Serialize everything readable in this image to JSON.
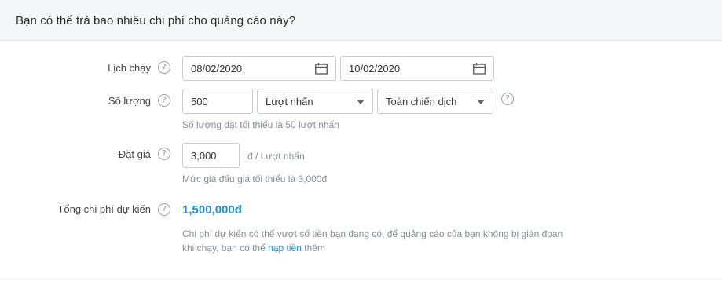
{
  "header": {
    "title": "Bạn có thể trả bao nhiêu chi phí cho quảng cáo này?"
  },
  "schedule": {
    "label": "Lịch chạy",
    "start_date": "08/02/2020",
    "end_date": "10/02/2020",
    "help_icon": "question-icon",
    "calendar_icon": "calendar-icon"
  },
  "quantity": {
    "label": "Số lượng",
    "value": "500",
    "unit_select": "Lượt nhấn",
    "scope_select": "Toàn chiến dịch",
    "hint": "Số lượng đặt tối thiểu là 50 lượt nhấn"
  },
  "bid": {
    "label": "Đặt giá",
    "value": "3,000",
    "unit": "đ / Lượt nhấn",
    "hint": "Mức giá đấu giá tối thiểu là 3,000đ"
  },
  "estimate": {
    "label": "Tổng chi phí dự kiến",
    "total": "1,500,000đ",
    "note_line1": "Chi phí dự kiến có thể vượt số tiền bạn đang có, để quảng cáo của bạn không bị gián đoạn",
    "note_line2_prefix": "khi chạy, bạn có thể",
    "note_link": "nạp tiền",
    "note_line2_suffix": "thêm"
  },
  "colors": {
    "accent": "#1a8fd8",
    "header_bg": "#f4f6f8",
    "border": "#c8ccd0",
    "hint": "#8a8f94"
  }
}
